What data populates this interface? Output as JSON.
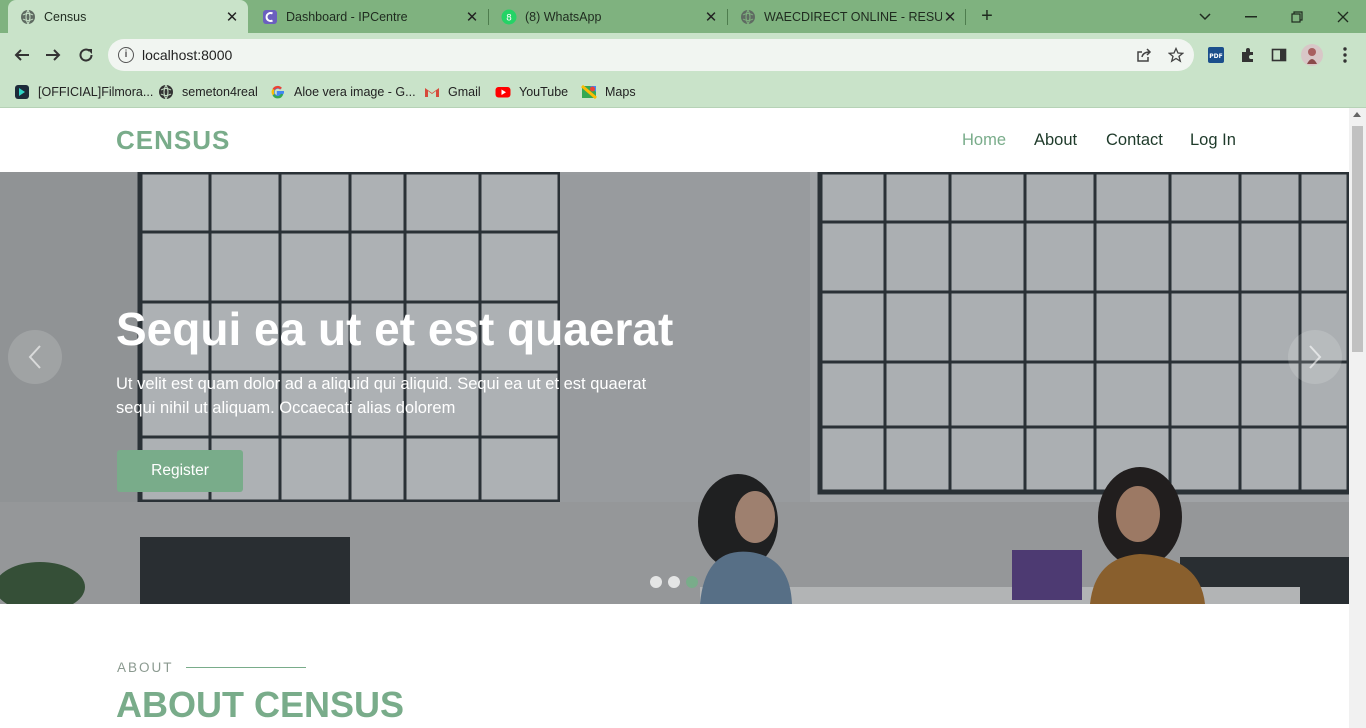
{
  "browser": {
    "tabs": [
      {
        "title": "Census",
        "active": true,
        "icon": "globe-icon"
      },
      {
        "title": "Dashboard - IPCentre",
        "active": false,
        "icon": "ipcentre-icon"
      },
      {
        "title": "(8) WhatsApp",
        "active": false,
        "icon": "whatsapp-icon"
      },
      {
        "title": "WAECDIRECT ONLINE - RESULT C",
        "active": false,
        "icon": "globe-icon"
      }
    ],
    "url": "localhost:8000",
    "bookmarks": [
      {
        "label": "[OFFICIAL]Filmora...",
        "icon": "filmora-icon"
      },
      {
        "label": "semeton4real",
        "icon": "globe-icon"
      },
      {
        "label": "Aloe vera image - G...",
        "icon": "google-icon"
      },
      {
        "label": "Gmail",
        "icon": "gmail-icon"
      },
      {
        "label": "YouTube",
        "icon": "youtube-icon"
      },
      {
        "label": "Maps",
        "icon": "maps-icon"
      }
    ]
  },
  "site": {
    "logo": "CENSUS",
    "nav": {
      "home": "Home",
      "about": "About",
      "contact": "Contact",
      "login": "Log In"
    },
    "hero": {
      "title": "Sequi ea ut et est quaerat",
      "text": "Ut velit est quam dolor ad a aliquid qui aliquid. Sequi ea ut et est quaerat sequi nihil ut aliquam. Occaecati alias dolorem",
      "button": "Register"
    },
    "about": {
      "label": "ABOUT",
      "title": "ABOUT CENSUS"
    }
  },
  "colors": {
    "accent": "#79ac8a",
    "chrome": "#7fb27f",
    "chrome_light": "#c9e3c9"
  }
}
